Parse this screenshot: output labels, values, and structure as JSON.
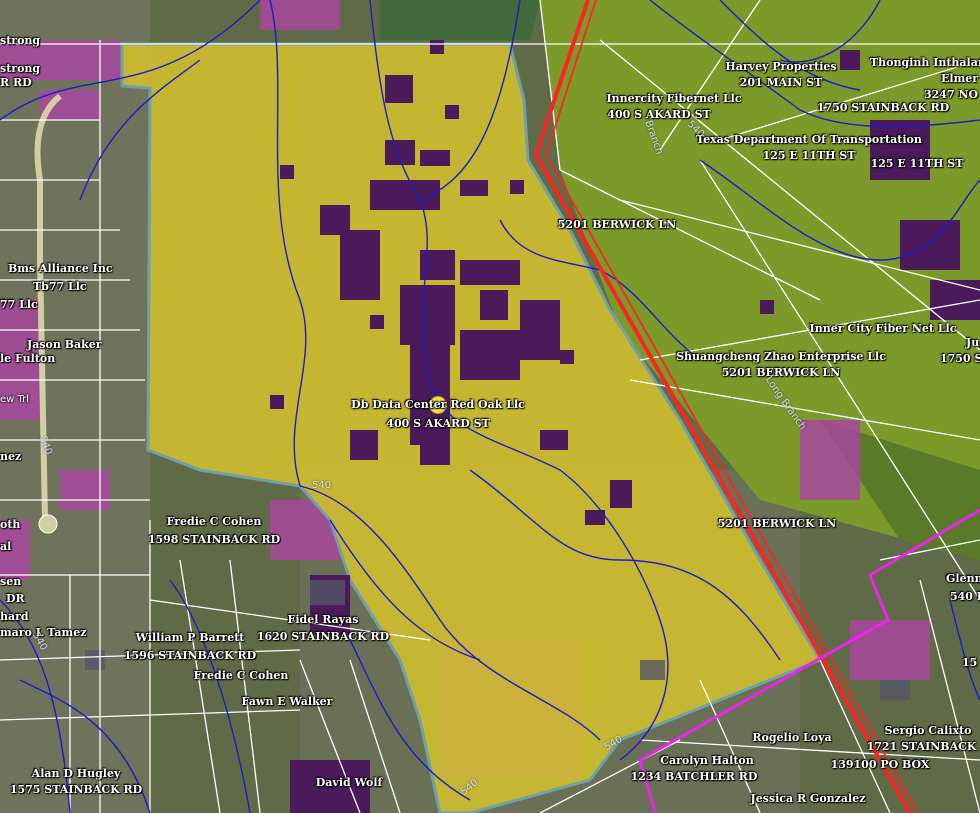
{
  "map": {
    "colors": {
      "parcel_fill": "#d2c12e",
      "parcel_outline": "#6fa8b6",
      "utility_line_red": "#ff2222",
      "boundary_magenta": "#ee22ee",
      "stream_blue": "#1c1cc8",
      "parcel_lines": "#ffffff",
      "land_purple": "#4b1a5a",
      "land_pink": "#b04aa8"
    },
    "icons": {
      "selected_parcel_marker": "location-marker-icon"
    },
    "labels": {
      "l01": "strong",
      "l02": "strong",
      "l03": "R RD",
      "l04": "Harvey Properties",
      "l05": "201 MAIN ST",
      "l06": "Thonginh Inthalar",
      "l07": "Elmer",
      "l08": "3247 NO",
      "l09": "Innercity Fibernet Llc",
      "l10": "400 S AKARD ST",
      "l11": "1750 STAINBACK RD",
      "l12": "Texas Department Of Transportation",
      "l13": "125 E 11TH ST",
      "l14": "125 E 11TH ST",
      "l15": "5201 BERWICK LN",
      "l16": "Bms Alliance Inc",
      "l17": "Tb77 Llc",
      "l18": "77 Llc",
      "l19": "Jason Baker",
      "l20": "le Fulton",
      "l21": "Inner City Fiber Net Llc",
      "l22": "Ju",
      "l23": "1750 S",
      "l24": "Shuangcheng Zhao Enterprise Llc",
      "l25": "5201 BERWICK LN",
      "l26": "Db Data Center Red Oak Llc",
      "l27": "400 S AKARD ST",
      "l28": "nez",
      "l29": "5201 BERWICK LN",
      "l30": "Fredie C Cohen",
      "l31": "1598 STAINBACK RD",
      "l32": "oth",
      "l33": "al",
      "l34": "Glenn",
      "l35": "540 B",
      "l36": "sen",
      "l37": "DR",
      "l38": "hard",
      "l39": "maro L Tamez",
      "l40": "Fidel Rayas",
      "l41": "1620 STAINBACK RD",
      "l42": "William P Barrett",
      "l43": "1596 STAINBACK RD",
      "l44": "Fredie C Cohen",
      "l45": "Fawn E Walker",
      "l46": "15",
      "l47": "Sergio Calixto",
      "l48": "1721 STAINBACK R",
      "l49": "139100 PO BOX",
      "l50": "Rogelio Loya",
      "l51": "Carolyn Halton",
      "l52": "1234 BATCHLER RD",
      "l53": "Alan D Hugley",
      "l54": "1575 STAINBACK RD",
      "l55": "David Wolf",
      "l56": "Jessica R Gonzalez"
    },
    "elevation_labels": [
      "540",
      "540",
      "540",
      "540",
      "540",
      "540"
    ],
    "water_labels": [
      "Branch",
      "Long Branch"
    ],
    "road_labels": [
      "ew Trl"
    ]
  }
}
